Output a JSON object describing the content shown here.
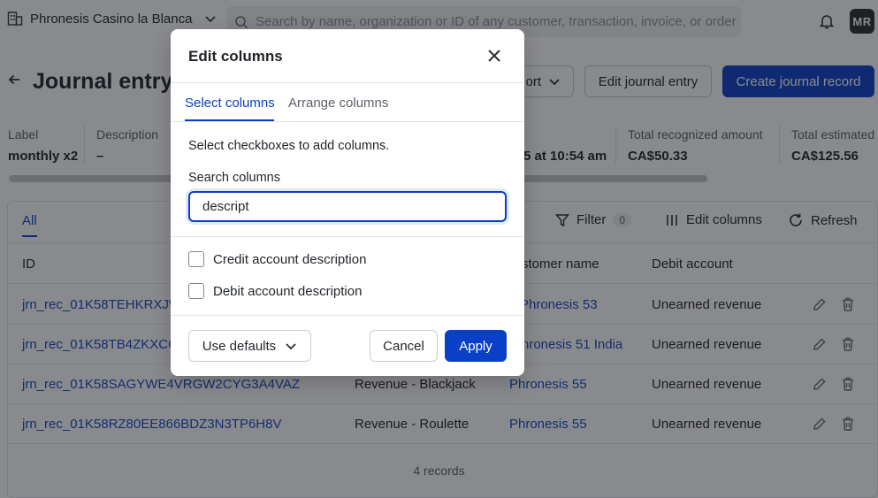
{
  "topbar": {
    "org_name": "Phronesis Casino la Blanca",
    "search_placeholder": "Search by name, organization or ID of any customer, transaction, invoice, or order",
    "avatar_initials": "MR"
  },
  "header": {
    "title": "Journal entry j",
    "export_label": "ort",
    "edit_entry_label": "Edit journal entry",
    "create_record_label": "Create journal record"
  },
  "meta": {
    "label_title": "Label",
    "label_value": "monthly x2",
    "description_title": "Description",
    "description_value": "–",
    "date_value": "5 at 10:54 am",
    "recognized_title": "Total recognized amount",
    "recognized_value": "CA$50.33",
    "estimated_title": "Total estimated",
    "estimated_value": "CA$125.56"
  },
  "table": {
    "tab_all": "All",
    "filter_label": "Filter",
    "filter_count": "0",
    "edit_columns_label": "Edit columns",
    "refresh_label": "Refresh",
    "columns": [
      "ID",
      "stomer name",
      "Debit account"
    ],
    "rows": [
      {
        "id": "jrn_rec_01K58TEHKRXJW",
        "credit": "",
        "customer": "Phronesis 53",
        "debit": "Unearned revenue"
      },
      {
        "id": "jrn_rec_01K58TB4ZKXCG",
        "credit": "",
        "customer": "hronesis 51 India",
        "debit": "Unearned revenue"
      },
      {
        "id": "jrn_rec_01K58SAGYWE4VRGW2CYG3A4VAZ",
        "credit": "Revenue - Blackjack",
        "customer": "Phronesis 55",
        "debit": "Unearned revenue"
      },
      {
        "id": "jrn_rec_01K58RZ80EE866BDZ3N3TP6H8V",
        "credit": "Revenue - Roulette",
        "customer": "Phronesis 55",
        "debit": "Unearned revenue"
      }
    ],
    "records_label": "4 records"
  },
  "modal": {
    "title": "Edit columns",
    "tab_select": "Select columns",
    "tab_arrange": "Arrange columns",
    "hint": "Select checkboxes to add columns.",
    "search_label": "Search columns",
    "search_value": "descript",
    "options": [
      {
        "label": "Credit account description",
        "checked": false
      },
      {
        "label": "Debit account description",
        "checked": false
      }
    ],
    "use_defaults_label": "Use defaults",
    "cancel_label": "Cancel",
    "apply_label": "Apply"
  },
  "colors": {
    "accent": "#0a3fc8",
    "link": "#1546c4",
    "overlay": "rgba(20,22,28,0.5)"
  }
}
